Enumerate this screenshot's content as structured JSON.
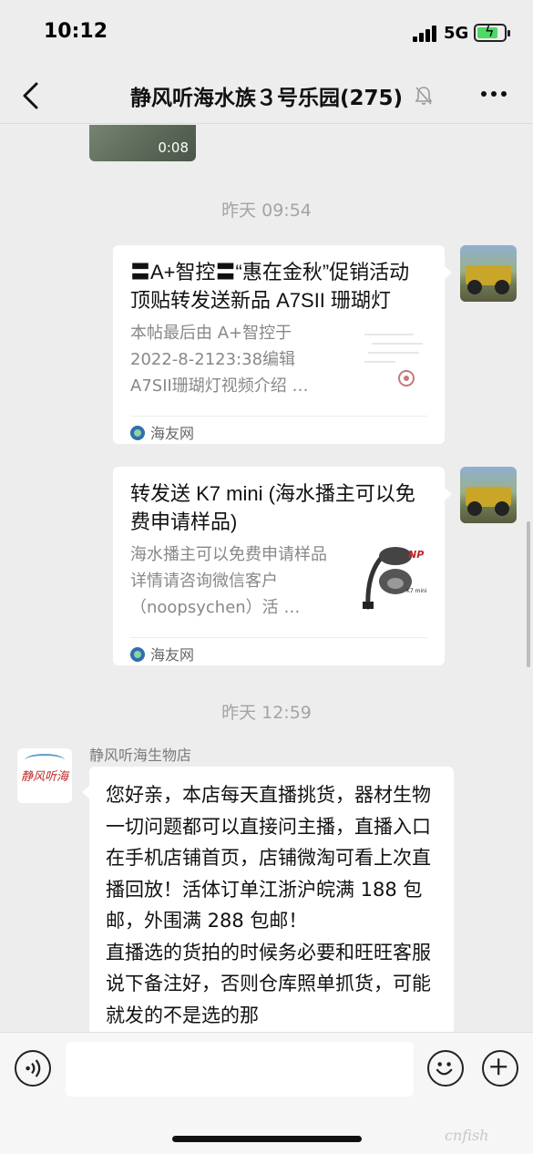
{
  "status_bar": {
    "time": "10:12",
    "network": "5G"
  },
  "header": {
    "title": "静风听海水族３号乐园(275)"
  },
  "chat": {
    "video": {
      "duration": "0:08"
    },
    "timestamps": [
      "昨天 09:54",
      "昨天 12:59"
    ],
    "cards": [
      {
        "title": "〓A+智控〓“惠在金秋”促销活动顶贴转发送新品 A7SII 珊瑚灯",
        "desc": "本帖最后由 A+智控于 2022-8-2123:38编辑 A7SII珊瑚灯视频介绍 …",
        "source": "海友网"
      },
      {
        "title": "转发送 K7 mini (海水播主可以免费申请样品)",
        "desc": "海水播主可以免费申请样品详情请咨询微信客户（noopsychen）活 …",
        "source": "海友网",
        "thumb_brand": "NP",
        "thumb_model": "K7 mini"
      }
    ],
    "message": {
      "sender": "静风听海生物店",
      "avatar_text": "静风听海",
      "text": "您好亲，本店每天直播挑货，器材生物一切问题都可以直接问主播，直播入口在手机店铺首页，店铺微淘可看上次直播回放！活体订单江浙沪皖满 188 包邮，外围满 288 包邮！\n直播选的货拍的时候务必要和旺旺客服说下备注好，否则仓库照单抓货，可能就发的不是选的那"
    }
  },
  "input_bar": {
    "placeholder": ""
  },
  "watermark": "cnfish"
}
